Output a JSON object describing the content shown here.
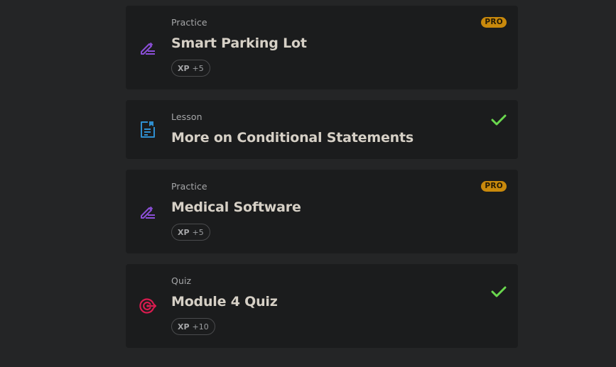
{
  "colors": {
    "background": "#242526",
    "card": "#1b1c1d",
    "practice_icon": "#8b4fd8",
    "lesson_icon": "#2f8fd0",
    "quiz_icon": "#d81b4f",
    "pro_badge": "#c9890c",
    "check": "#6ad84e"
  },
  "items": [
    {
      "type": "Practice",
      "icon": "pencil-icon",
      "title": "Smart Parking Lot",
      "badge": "PRO",
      "xp_label": "XP",
      "xp_value": "+5",
      "completed": false
    },
    {
      "type": "Lesson",
      "icon": "document-icon",
      "title": "More on Conditional Statements",
      "completed": true,
      "status_icon": "checkmark-icon"
    },
    {
      "type": "Practice",
      "icon": "pencil-icon",
      "title": "Medical Software",
      "badge": "PRO",
      "xp_label": "XP",
      "xp_value": "+5",
      "completed": false
    },
    {
      "type": "Quiz",
      "icon": "target-icon",
      "title": "Module 4 Quiz",
      "xp_label": "XP",
      "xp_value": "+10",
      "completed": true,
      "status_icon": "checkmark-icon"
    }
  ]
}
